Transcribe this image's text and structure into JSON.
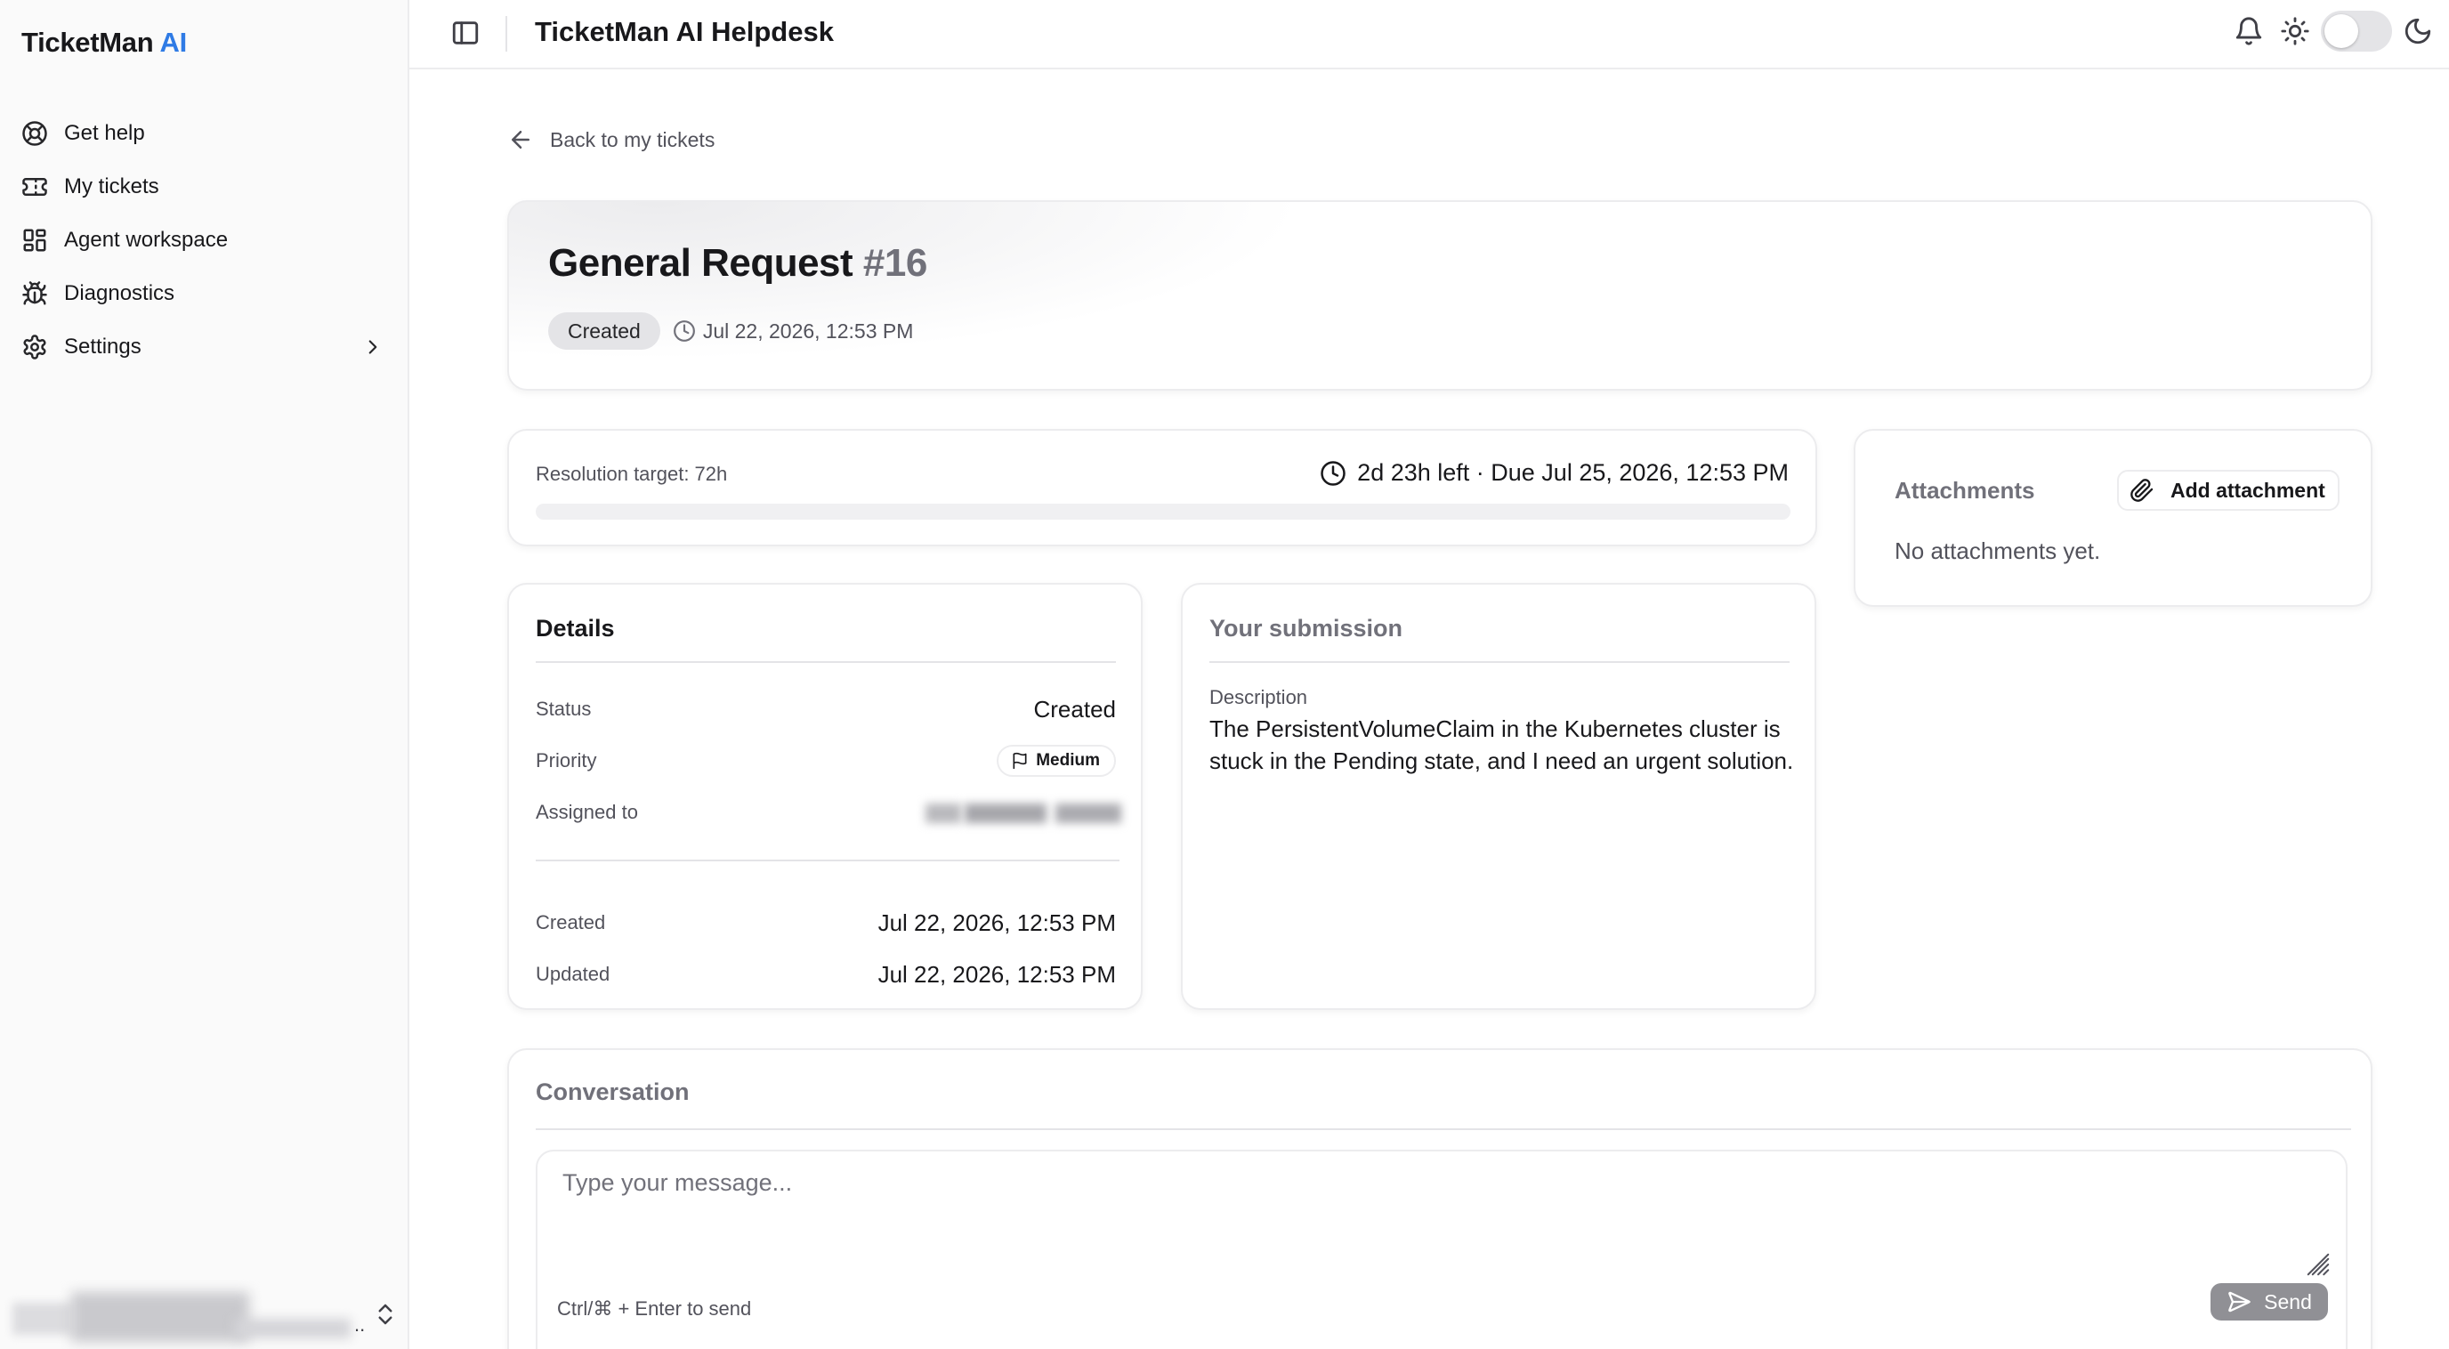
{
  "sidebar": {
    "brand_name": "TicketMan",
    "brand_suffix": "AI",
    "items": [
      {
        "label": "Get help",
        "icon": "lifebuoy-icon"
      },
      {
        "label": "My tickets",
        "icon": "ticket-icon"
      },
      {
        "label": "Agent workspace",
        "icon": "dashboard-icon"
      },
      {
        "label": "Diagnostics",
        "icon": "bug-icon"
      },
      {
        "label": "Settings",
        "icon": "gear-icon"
      }
    ],
    "user_ellipsis": ".."
  },
  "topbar": {
    "title": "TicketMan AI Helpdesk"
  },
  "back_link": "Back to my tickets",
  "ticket": {
    "title": "General Request",
    "number": "#16",
    "status_chip": "Created",
    "created_at": "Jul 22, 2026, 12:53 PM"
  },
  "sla": {
    "label": "Resolution target: 72h",
    "remaining": "2d 23h left · Due Jul 25, 2026, 12:53 PM",
    "progress_fraction": 0.0
  },
  "attachments": {
    "title": "Attachments",
    "add_label": "Add attachment",
    "empty_text": "No attachments yet."
  },
  "details": {
    "title": "Details",
    "status_label": "Status",
    "status_value": "Created",
    "priority_label": "Priority",
    "priority_value": "Medium",
    "assigned_label": "Assigned to",
    "created_label": "Created",
    "created_value": "Jul 22, 2026, 12:53 PM",
    "updated_label": "Updated",
    "updated_value": "Jul 22, 2026, 12:53 PM"
  },
  "submission": {
    "title": "Your submission",
    "description_label": "Description",
    "description": "The PersistentVolumeClaim in the Kubernetes cluster is stuck in the Pending state, and I need an urgent solution."
  },
  "conversation": {
    "title": "Conversation",
    "placeholder": "Type your message...",
    "hint": "Ctrl/⌘ + Enter to send",
    "send_label": "Send"
  },
  "colors": {
    "accent": "#2f7be5",
    "send_disabled": "#909095"
  }
}
